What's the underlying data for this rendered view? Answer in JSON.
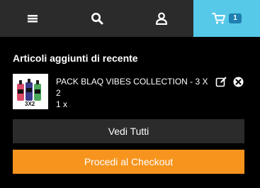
{
  "nav": {
    "items": [
      {
        "icon": "menu-icon"
      },
      {
        "icon": "search-icon"
      },
      {
        "icon": "user-icon"
      },
      {
        "icon": "cart-icon",
        "badge": "1"
      }
    ],
    "cart_bg": "#56c8e8",
    "bar_bg": "#2b2b2b"
  },
  "cart_panel": {
    "title": "Articoli aggiunti di recente",
    "items": [
      {
        "name": "PACK BLAQ VIBES COLLECTION - 3 X 2",
        "qty": "1 x",
        "thumb_label": "3X2"
      }
    ],
    "view_all_label": "Vedi Tutti",
    "checkout_label": "Procedi al Checkout",
    "checkout_color": "#f7941d"
  }
}
